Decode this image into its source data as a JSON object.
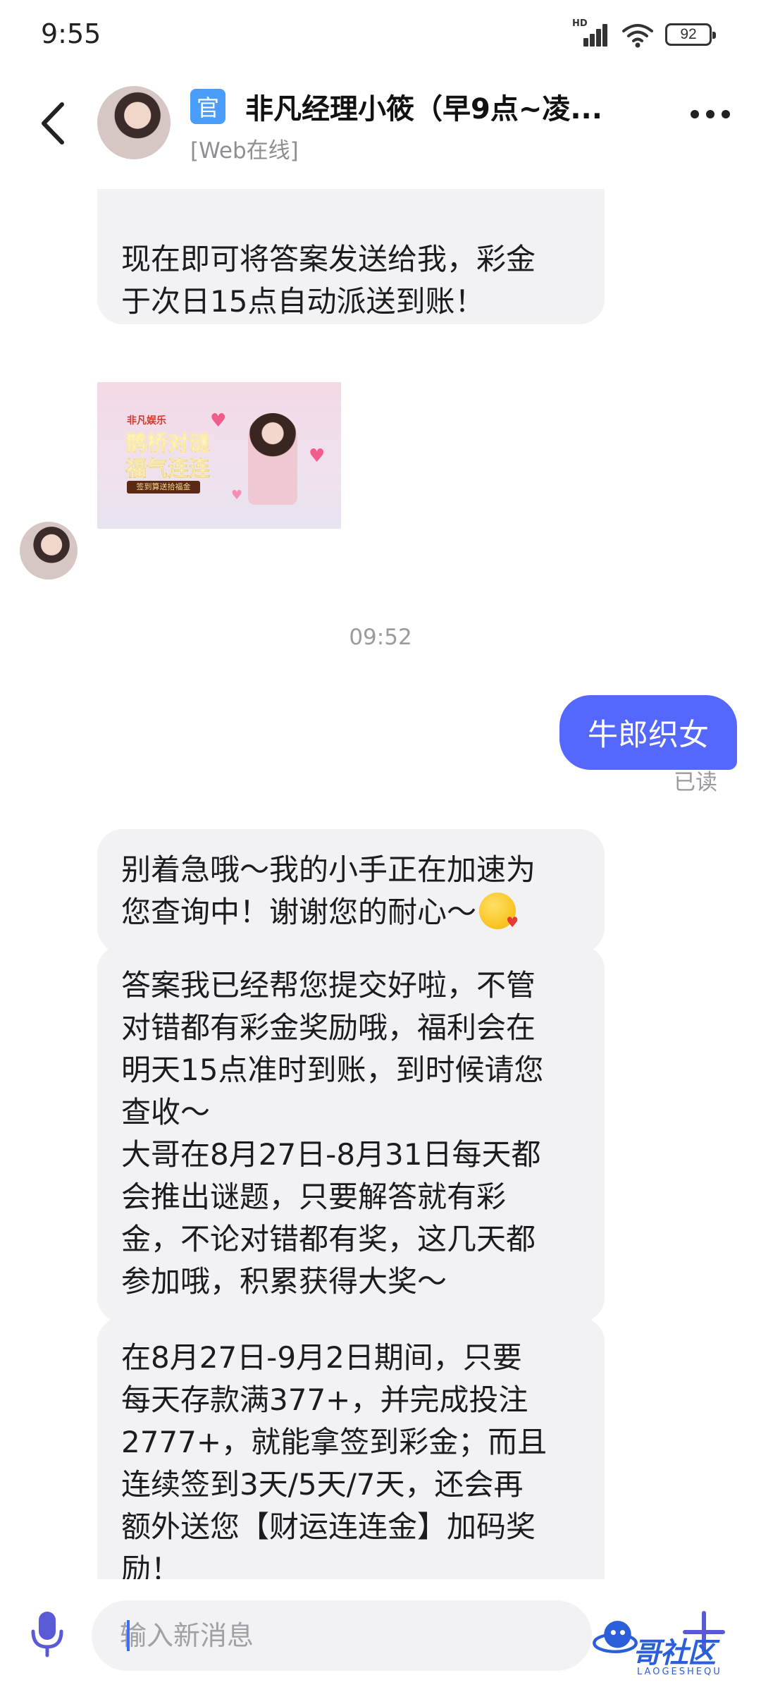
{
  "status_bar": {
    "time": "9:55",
    "network": "HD",
    "battery": "92"
  },
  "header": {
    "official_badge": "官",
    "title": "非凡经理小筱（早9点~凌...",
    "status": "[Web在线]"
  },
  "messages": {
    "incoming_1": "现在即可将答案发送给我，彩金\n于次日15点自动派送到账！",
    "promo_image": {
      "logo_text": "非凡娱乐",
      "title_line1": "鹊桥对谜",
      "title_line2": "福气连连",
      "subtitle": "签到算送拾福金"
    },
    "time_divider": "09:52",
    "outgoing_1": "牛郎织女",
    "read_receipt": "已读",
    "incoming_2": "别着急哦～我的小手正在加速为\n您查询中！谢谢您的耐心～",
    "incoming_3": "答案我已经帮您提交好啦，不管\n对错都有彩金奖励哦，福利会在\n明天15点准时到账，到时候请您\n查收～\n大哥在8月27日-8月31日每天都\n会推出谜题，只要解答就有彩\n金，不论对错都有奖，这几天都\n参加哦，积累获得大奖～",
    "incoming_4": "在8月27日-9月2日期间，只要\n每天存款满377+，并完成投注\n2777+，就能拿签到彩金；而且\n连续签到3天/5天/7天，还会再\n额外送您【财运连连金】加码奖\n励！"
  },
  "input_bar": {
    "placeholder": "输入新消息"
  },
  "watermark": {
    "text": "哥社区",
    "sub": "LAOGESHEQU"
  },
  "colors": {
    "accent": "#5467ff",
    "bubble_in": "#f2f2f4",
    "badge": "#4a9df8"
  }
}
